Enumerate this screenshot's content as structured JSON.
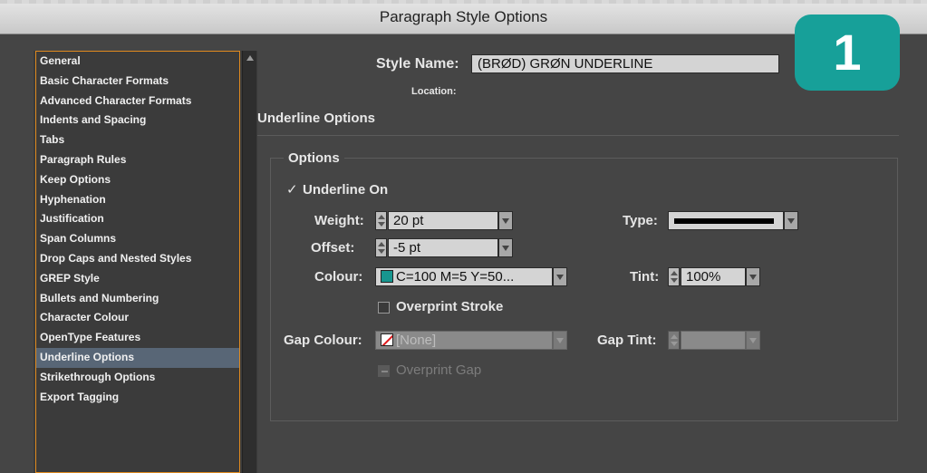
{
  "window": {
    "title": "Paragraph Style Options"
  },
  "sidebar": {
    "items": [
      "General",
      "Basic Character Formats",
      "Advanced Character Formats",
      "Indents and Spacing",
      "Tabs",
      "Paragraph Rules",
      "Keep Options",
      "Hyphenation",
      "Justification",
      "Span Columns",
      "Drop Caps and Nested Styles",
      "GREP Style",
      "Bullets and Numbering",
      "Character Colour",
      "OpenType Features",
      "Underline Options",
      "Strikethrough Options",
      "Export Tagging"
    ],
    "active_index": 15
  },
  "header": {
    "style_name_label": "Style Name:",
    "style_name_value": "(BRØD) GRØN UNDERLINE",
    "location_label": "Location:"
  },
  "badge": {
    "text": "1",
    "color": "#17a099"
  },
  "section": {
    "title": "Underline Options"
  },
  "options": {
    "group_title": "Options",
    "underline_on_label": "Underline On",
    "underline_on_checked": true,
    "weight_label": "Weight:",
    "weight_value": "20 pt",
    "type_label": "Type:",
    "offset_label": "Offset:",
    "offset_value": "-5 pt",
    "colour_label": "Colour:",
    "colour_value": "C=100 M=5 Y=50...",
    "colour_swatch": "#17968f",
    "tint_label": "Tint:",
    "tint_value": "100%",
    "overprint_stroke_label": "Overprint Stroke",
    "gap_colour_label": "Gap Colour:",
    "gap_colour_value": "[None]",
    "gap_tint_label": "Gap Tint:",
    "overprint_gap_label": "Overprint Gap"
  }
}
